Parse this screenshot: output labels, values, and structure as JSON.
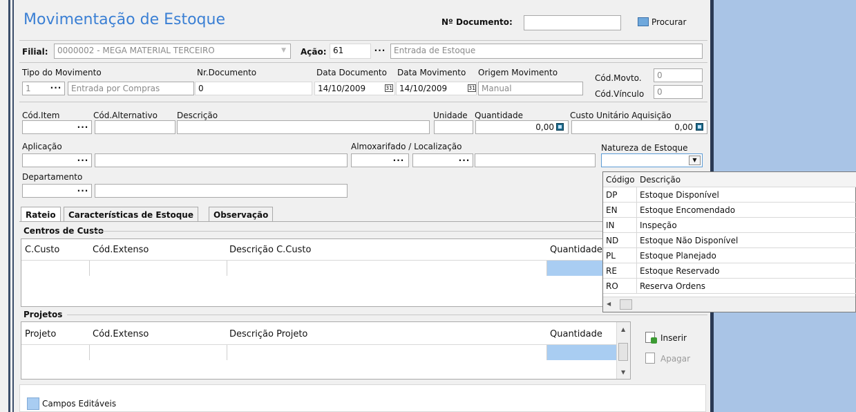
{
  "window": {
    "title": "Movimentação de Estoque",
    "doc_label": "Nº Documento:",
    "doc_value": "",
    "search_label": "Procurar"
  },
  "filial": {
    "label": "Filial:",
    "value": "0000002 - MEGA MATERIAL TERCEIRO"
  },
  "acao": {
    "label": "Ação:",
    "code": "61",
    "description": "Entrada de Estoque"
  },
  "movimento": {
    "tipo_label": "Tipo do Movimento",
    "tipo_code": "1",
    "tipo_desc": "Entrada por Compras",
    "nr_doc_label": "Nr.Documento",
    "nr_doc_value": "0",
    "data_doc_label": "Data Documento",
    "data_doc_value": "14/10/2009",
    "data_mov_label": "Data Movimento",
    "data_mov_value": "14/10/2009",
    "origem_label": "Origem Movimento",
    "origem_value": "Manual",
    "cod_movto_label": "Cód.Movto.",
    "cod_movto_value": "0",
    "cod_vinculo_label": "Cód.Vínculo",
    "cod_vinculo_value": "0"
  },
  "item": {
    "cod_item_label": "Cód.Item",
    "cod_alt_label": "Cód.Alternativo",
    "descricao_label": "Descrição",
    "unidade_label": "Unidade",
    "quantidade_label": "Quantidade",
    "quantidade_value": "0,00",
    "custo_label": "Custo Unitário Aquisição",
    "custo_value": "0,00",
    "aplicacao_label": "Aplicação",
    "almox_label": "Almoxarifado / Localização",
    "natureza_label": "Natureza de Estoque",
    "departamento_label": "Departamento"
  },
  "tabs": [
    "Rateio",
    "Características de Estoque",
    "Observação"
  ],
  "centros": {
    "title": "Centros de Custo",
    "headers": [
      "C.Custo",
      "Cód.Extenso",
      "Descrição C.Custo",
      "Quantidade"
    ]
  },
  "projetos": {
    "title": "Projetos",
    "headers": [
      "Projeto",
      "Cód.Extenso",
      "Descrição Projeto",
      "Quantidade"
    ],
    "insert_label": "Inserir",
    "delete_label": "Apagar"
  },
  "legend": {
    "label": "Campos Editáveis",
    "color": "#a9cdf2"
  },
  "natureza_dropdown": {
    "headers": [
      "Código",
      "Descrição"
    ],
    "rows": [
      {
        "code": "DP",
        "desc": "Estoque Disponível"
      },
      {
        "code": "EN",
        "desc": "Estoque Encomendado"
      },
      {
        "code": "IN",
        "desc": "Inspeção"
      },
      {
        "code": "ND",
        "desc": "Estoque Não Disponível"
      },
      {
        "code": "PL",
        "desc": "Estoque Planejado"
      },
      {
        "code": "RE",
        "desc": "Estoque Reservado"
      },
      {
        "code": "RO",
        "desc": "Reserva Ordens"
      }
    ]
  },
  "colors": {
    "title": "#3a7fd4",
    "editable": "#a9cdf2",
    "background": "#a9c4e6"
  }
}
